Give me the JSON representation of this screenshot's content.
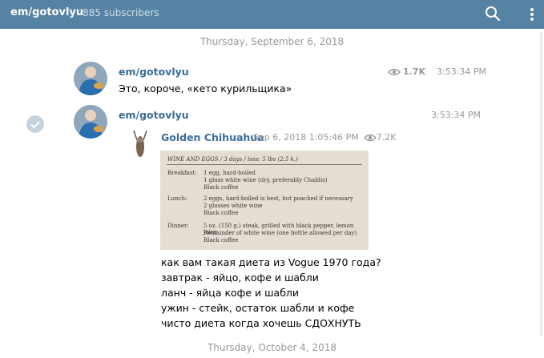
{
  "header": {
    "title": "em/gotovlyu",
    "subscribers": "885 subscribers"
  },
  "dates": {
    "first": "Thursday, September 6, 2018",
    "second": "Thursday, October 4, 2018"
  },
  "messages": [
    {
      "author": "em/gotovlyu",
      "text": "Это, короче, «кето курильщика»",
      "views": "1.7K",
      "time": "3:53:34 PM"
    },
    {
      "author": "em/gotovlyu",
      "time": "3:53:34 PM",
      "forwarded": {
        "author": "Golden Chihuahua",
        "date": "Sep 6, 2018 1:05:46 PM",
        "views": "7.2K",
        "photo": {
          "heading": "WINE AND EGGS / 3 days / loss: 5 lbs (2.5 k.)",
          "breakfast_label": "Breakfast:",
          "breakfast_lines": [
            "1 egg, hard-boiled",
            "1 glass white wine (dry, preferably Chablis)",
            "Black coffee"
          ],
          "lunch_label": "Lunch:",
          "lunch_lines": [
            "2 eggs, hard-boiled is best, but poached if necessary",
            "2 glasses white wine",
            "Black coffee"
          ],
          "dinner_label": "Dinner:",
          "dinner_lines": [
            "5 oz. (150 g.) steak, grilled with black pepper, lemon juice",
            "Remainder of white wine (one bottle allowed per day)",
            "Black coffee"
          ]
        },
        "caption_lines": [
          "как вам такая диета из Vogue 1970 года?",
          "завтрак - яйцо, кофе и шабли",
          "ланч - яйца кофе и шабли",
          "ужин - стейк, остаток шабли и кофе",
          "чисто диета когда хочешь СДОХНУТЬ"
        ]
      }
    }
  ],
  "colors": {
    "header_bg": "#5682a3",
    "author": "#3a6d99",
    "meta": "#999999"
  }
}
